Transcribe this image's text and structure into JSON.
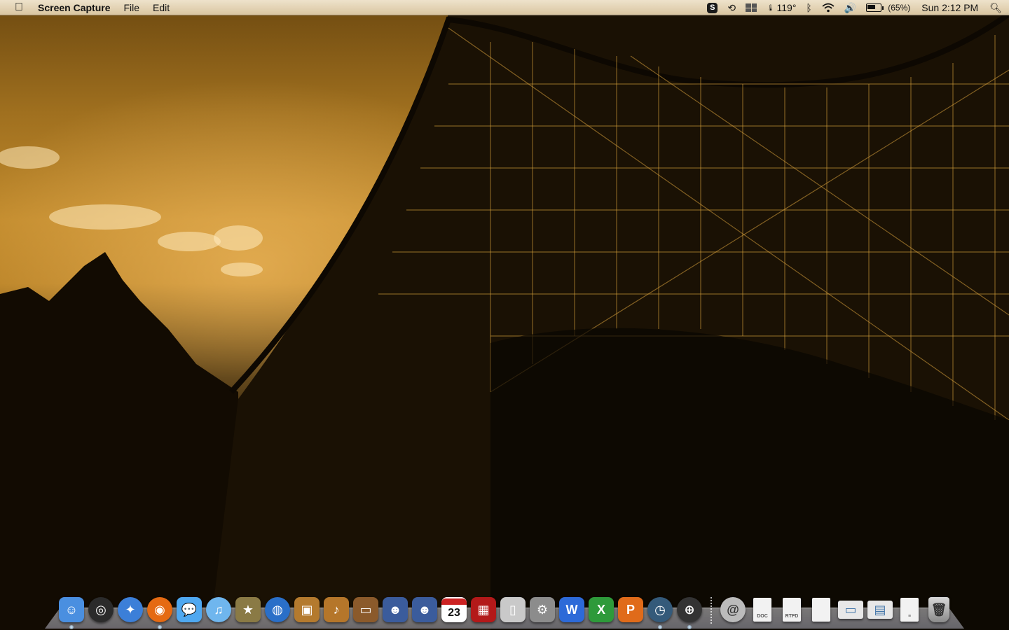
{
  "menubar": {
    "app_name": "Screen Capture",
    "menus": [
      "File",
      "Edit"
    ],
    "status": {
      "skype_letter": "S",
      "temperature": "119°",
      "battery_percent": "(65%)",
      "battery_level": 0.65,
      "clock": "Sun 2:12 PM"
    },
    "icons": [
      "apple-icon",
      "skype-icon",
      "time-machine-icon",
      "spaces-icon",
      "temperature-icon",
      "bluetooth-icon",
      "wifi-icon",
      "volume-icon",
      "battery-icon",
      "spotlight-icon"
    ]
  },
  "dock": {
    "apps": [
      {
        "name": "finder",
        "color": "#4a8fe0",
        "glyph": "☺",
        "running": true
      },
      {
        "name": "dashboard",
        "color": "#2b2b2b",
        "glyph": "◎",
        "running": false
      },
      {
        "name": "safari",
        "color": "#3c7fd8",
        "glyph": "✦",
        "running": false
      },
      {
        "name": "firefox",
        "color": "#e56a12",
        "glyph": "◉",
        "running": true
      },
      {
        "name": "ichat",
        "color": "#4fa8f0",
        "glyph": "💬",
        "running": false
      },
      {
        "name": "itunes",
        "color": "#6fb6ee",
        "glyph": "♫",
        "running": false
      },
      {
        "name": "imovie",
        "color": "#8a7a45",
        "glyph": "★",
        "running": false
      },
      {
        "name": "dvd-player",
        "color": "#2a6fc8",
        "glyph": "◍",
        "running": false
      },
      {
        "name": "iphoto",
        "color": "#b47a2e",
        "glyph": "▣",
        "running": false
      },
      {
        "name": "garageband",
        "color": "#b5762a",
        "glyph": "♪",
        "running": false
      },
      {
        "name": "front-row",
        "color": "#8b5a2b",
        "glyph": "▭",
        "running": false
      },
      {
        "name": "adium",
        "color": "#3b5c9c",
        "glyph": "☻",
        "running": false
      },
      {
        "name": "adium-2",
        "color": "#3b5c9c",
        "glyph": "☻",
        "running": false
      },
      {
        "name": "ical",
        "color": "#ffffff",
        "glyph": "23",
        "running": false
      },
      {
        "name": "photo-booth",
        "color": "#b31919",
        "glyph": "▦",
        "running": false
      },
      {
        "name": "remote",
        "color": "#c9c9c9",
        "glyph": "▯",
        "running": false
      },
      {
        "name": "system-preferences",
        "color": "#8c8c8c",
        "glyph": "⚙",
        "running": false
      },
      {
        "name": "word",
        "color": "#2d6ad8",
        "glyph": "W",
        "running": false
      },
      {
        "name": "excel",
        "color": "#2e9a3a",
        "glyph": "X",
        "running": false
      },
      {
        "name": "powerpoint",
        "color": "#e06b1a",
        "glyph": "P",
        "running": false
      },
      {
        "name": "time-machine",
        "color": "#345a7a",
        "glyph": "◷",
        "running": true
      },
      {
        "name": "screen-capture",
        "color": "#333333",
        "glyph": "⊕",
        "running": true
      }
    ],
    "stack": [
      {
        "name": "mail-stack",
        "type": "round",
        "glyph": "@"
      },
      {
        "name": "doc-file",
        "type": "doc",
        "glyph": "DOC"
      },
      {
        "name": "rtfd-file",
        "type": "doc",
        "glyph": "RTFD"
      },
      {
        "name": "blank-document",
        "type": "doc",
        "glyph": ""
      },
      {
        "name": "image-file",
        "type": "wide",
        "glyph": "▭"
      },
      {
        "name": "screenshot-file",
        "type": "wide",
        "glyph": "▤"
      },
      {
        "name": "text-file",
        "type": "doc",
        "glyph": "≡"
      },
      {
        "name": "trash",
        "type": "trash",
        "glyph": "🗑"
      }
    ]
  }
}
